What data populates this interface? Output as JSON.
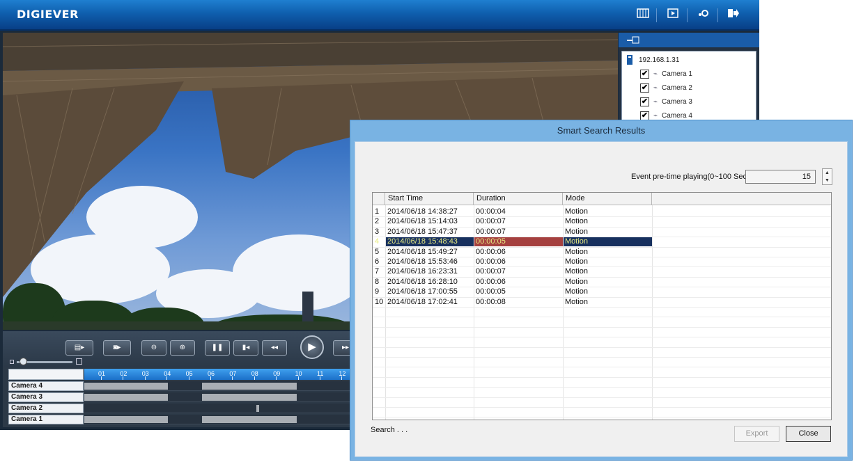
{
  "app": {
    "brand": "DIGIEVER",
    "toolbar_icons": [
      "layout-icon",
      "playback-icon",
      "settings-icon",
      "logout-icon"
    ]
  },
  "device_tree": {
    "server": "192.168.1.31",
    "cameras": [
      {
        "label": "Camera 1",
        "checked": true
      },
      {
        "label": "Camera 2",
        "checked": true
      },
      {
        "label": "Camera 3",
        "checked": true
      },
      {
        "label": "Camera 4",
        "checked": true
      }
    ]
  },
  "timeline": {
    "hour_labels": [
      "01",
      "02",
      "03",
      "04",
      "05",
      "06",
      "07",
      "08",
      "09",
      "10",
      "11",
      "12"
    ],
    "tracks": [
      "Camera 4",
      "Camera 3",
      "Camera 2",
      "Camera 1"
    ]
  },
  "dialog": {
    "title": "Smart Search Results",
    "pretime_label": "Event pre-time playing(0~100 Sec.):",
    "pretime_value": "15",
    "columns": [
      "",
      "Start Time",
      "Duration",
      "Mode"
    ],
    "rows": [
      {
        "index": "1",
        "start": "2014/06/18 14:38:27",
        "duration": "00:00:04",
        "mode": "Motion"
      },
      {
        "index": "2",
        "start": "2014/06/18 15:14:03",
        "duration": "00:00:07",
        "mode": "Motion"
      },
      {
        "index": "3",
        "start": "2014/06/18 15:47:37",
        "duration": "00:00:07",
        "mode": "Motion"
      },
      {
        "index": "4",
        "start": "2014/06/18 15:48:43",
        "duration": "00:00:05",
        "mode": "Motion"
      },
      {
        "index": "5",
        "start": "2014/06/18 15:49:27",
        "duration": "00:00:06",
        "mode": "Motion"
      },
      {
        "index": "6",
        "start": "2014/06/18 15:53:46",
        "duration": "00:00:06",
        "mode": "Motion"
      },
      {
        "index": "7",
        "start": "2014/06/18 16:23:31",
        "duration": "00:00:07",
        "mode": "Motion"
      },
      {
        "index": "8",
        "start": "2014/06/18 16:28:10",
        "duration": "00:00:06",
        "mode": "Motion"
      },
      {
        "index": "9",
        "start": "2014/06/18 17:00:55",
        "duration": "00:00:05",
        "mode": "Motion"
      },
      {
        "index": "10",
        "start": "2014/06/18 17:02:41",
        "duration": "00:00:08",
        "mode": "Motion"
      }
    ],
    "selected_row": 3,
    "status": "Search . . .",
    "export_label": "Export",
    "close_label": "Close"
  },
  "colors": {
    "accent_blue": "#0f5fae",
    "selection": "#17305e",
    "selection_duration": "#a5403f"
  }
}
